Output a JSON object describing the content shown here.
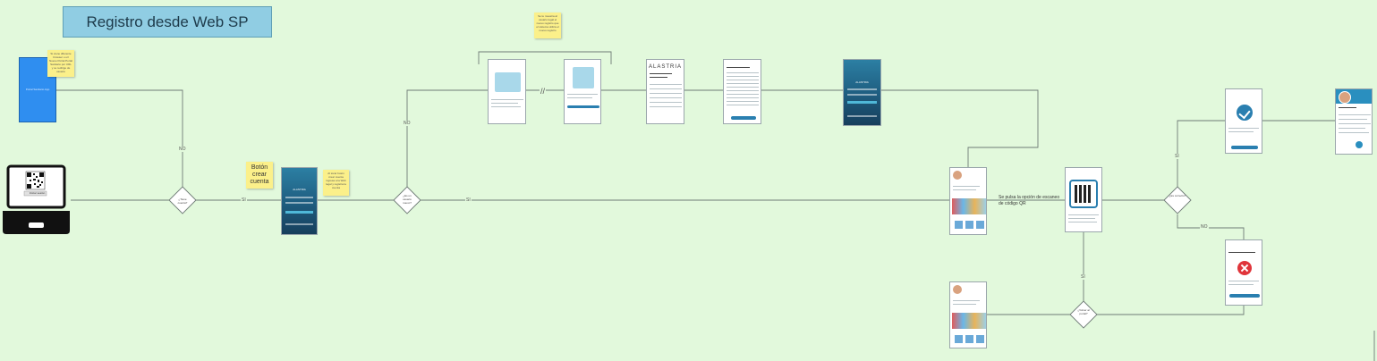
{
  "title": "Registro desde Web SP",
  "stickies": {
    "boton_crear_cuenta": "Botón crear cuenta",
    "top_left_note": "Si viene diferente browser o url Nuevo Portal Portal Sanitario por URL y se redirige de usuario",
    "top_middle_note": "Se le muestra al usuario legal el nuevo registro que el sistema utiliza el nuevo registro",
    "middle_note": "Al tocar botón crear cuenta ingresa a la Web legal y registra la cuenta"
  },
  "edge_labels": {
    "no_top": "NO",
    "si_first": "SI",
    "no_branch": "NO",
    "si_second": "SI",
    "si_upper_right": "SI",
    "no_lower_right": "NO",
    "si_vertical": "SI",
    "separator": "//"
  },
  "annotation": "Se pulsa la opción de escaneo de código QR",
  "diamonds": {
    "d1": "¿Tiene cuenta?",
    "d2": "¿Es un usuario nuevo?",
    "d3": "¿Es correcto?",
    "d4": "¿Volver al portal?"
  },
  "blue_box_text": "Portal Sanitario App",
  "laptop_button": "Iniciar sesión",
  "app_brand": "ALASTRIA"
}
